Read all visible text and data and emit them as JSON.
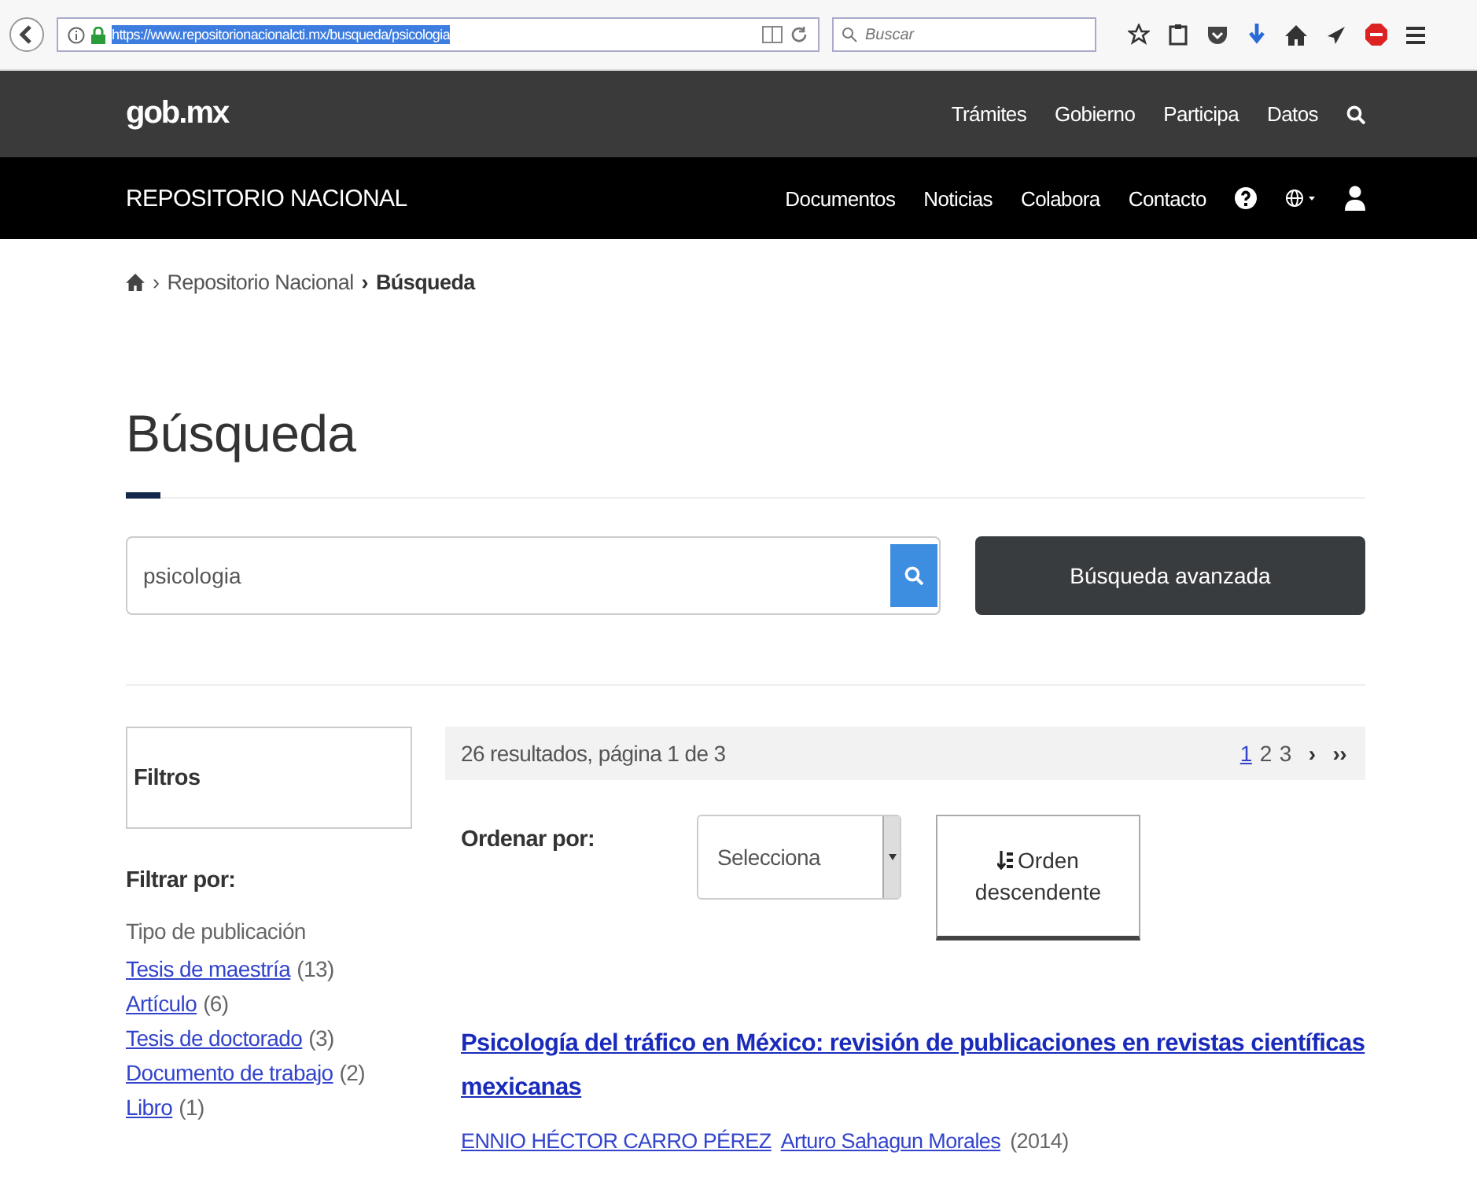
{
  "browser": {
    "url": "https://www.repositorionacionalcti.mx/busqueda/psicologia",
    "search_placeholder": "Buscar"
  },
  "top_nav": {
    "logo": "gob.mx",
    "links": [
      "Trámites",
      "Gobierno",
      "Participa",
      "Datos"
    ]
  },
  "sub_nav": {
    "title": "REPOSITORIO NACIONAL",
    "links": [
      "Documentos",
      "Noticias",
      "Colabora",
      "Contacto"
    ]
  },
  "breadcrumb": {
    "separator": "›",
    "items": [
      "Repositorio Nacional"
    ],
    "current": "Búsqueda"
  },
  "heading": "Búsqueda",
  "search": {
    "value": "psicologia",
    "advanced_button": "Búsqueda avanzada"
  },
  "sidebar": {
    "title": "Filtros",
    "filter_heading": "Filtrar por:",
    "group": "Tipo de publicación",
    "filters": [
      {
        "label": "Tesis de maestría",
        "count": "(13)"
      },
      {
        "label": "Artículo",
        "count": "(6)"
      },
      {
        "label": "Tesis de doctorado",
        "count": "(3)"
      },
      {
        "label": "Documento de trabajo",
        "count": "(2)"
      },
      {
        "label": "Libro",
        "count": "(1)"
      }
    ]
  },
  "results": {
    "summary": "26 resultados, página 1 de 3",
    "pages": [
      {
        "label": "1",
        "selected": true
      },
      {
        "label": "2",
        "selected": false
      },
      {
        "label": "3",
        "selected": false
      }
    ],
    "next": "›",
    "last": "››",
    "sort_label": "Ordenar por:",
    "sort_select": "Selecciona",
    "order_button": [
      "Orden",
      "descendente"
    ],
    "items": [
      {
        "title": "Psicología del tráfico en México: revisión de publicaciones en revistas científicas mexicanas",
        "authors": [
          "ENNIO HÉCTOR CARRO PÉREZ",
          "Arturo Sahagun Morales"
        ],
        "year": "(2014)"
      }
    ]
  }
}
